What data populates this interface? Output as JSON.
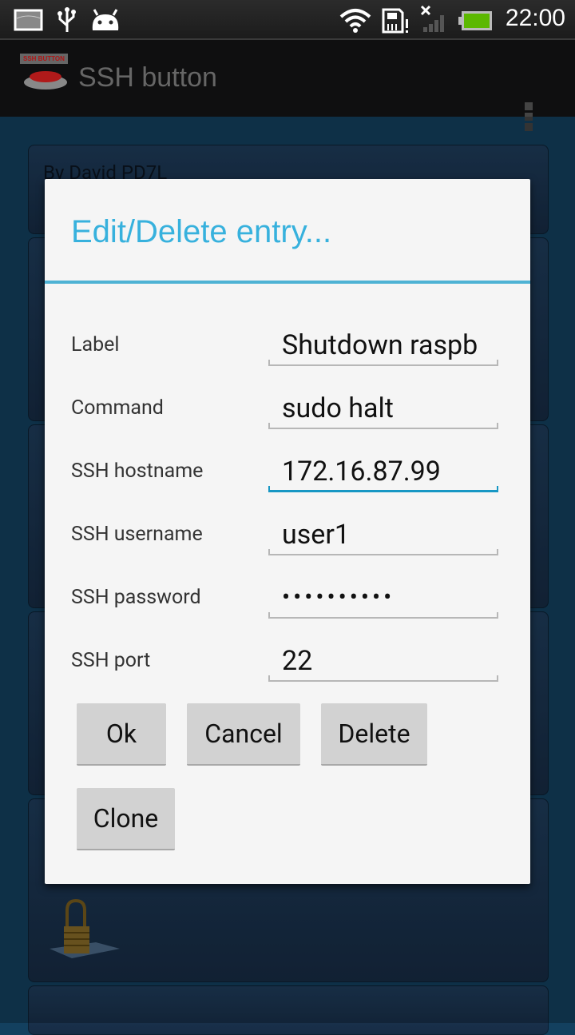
{
  "status_bar": {
    "time": "22:00",
    "icons": [
      "image-notification-icon",
      "usb-icon",
      "android-debug-icon",
      "wifi-icon",
      "sd-card-warning-icon",
      "no-signal-icon",
      "battery-icon"
    ],
    "battery_color": "#5cb800"
  },
  "action_bar": {
    "app_title": "SSH button",
    "logo_label": "SSH BUTTON",
    "overflow_icon": "overflow-menu-icon"
  },
  "background": {
    "author_text": "By David PD7L",
    "lock_icon": "padlock-icon"
  },
  "dialog": {
    "title": "Edit/Delete entry...",
    "title_color": "#37b1dd",
    "fields": [
      {
        "label": "Label",
        "value": "Shutdown raspb"
      },
      {
        "label": "Command",
        "value": "sudo halt"
      },
      {
        "label": "SSH hostname",
        "value": "172.16.87.99"
      },
      {
        "label": "SSH username",
        "value": "user1"
      },
      {
        "label": "SSH password",
        "value": "••••••••••"
      },
      {
        "label": "SSH port",
        "value": "22"
      }
    ],
    "buttons": {
      "ok": "Ok",
      "cancel": "Cancel",
      "delete": "Delete",
      "clone": "Clone"
    }
  }
}
